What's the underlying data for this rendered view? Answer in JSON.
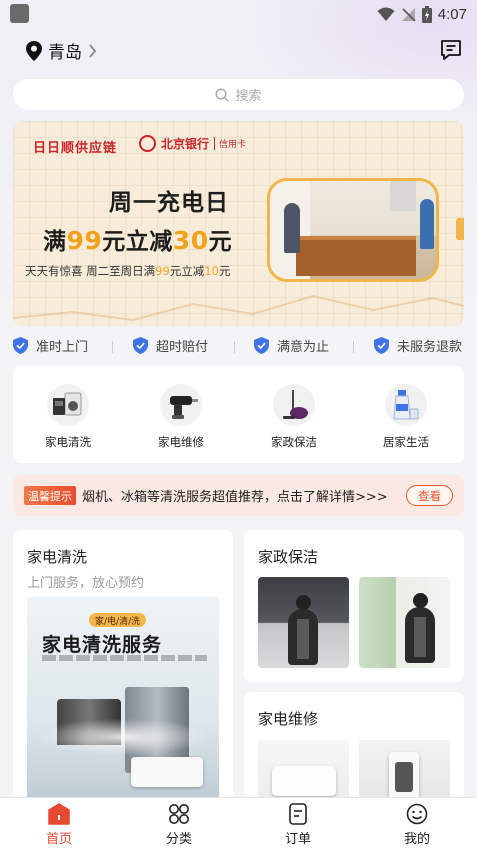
{
  "status_bar": {
    "time": "4:07"
  },
  "header": {
    "city": "青岛"
  },
  "search": {
    "placeholder": "搜索"
  },
  "banner": {
    "brand1": "日日顺供应链",
    "brand2_name": "北京银行",
    "brand2_sub": "信用卡",
    "title": "周一充电日",
    "promo_parts": [
      "满",
      "99",
      "元立减",
      "30",
      "元"
    ],
    "sub_parts": [
      "天天有惊喜 周二至周日满",
      "99",
      "元立减",
      "10",
      "元"
    ]
  },
  "guarantees": [
    "准时上门",
    "超时赔付",
    "满意为止",
    "未服务退款"
  ],
  "services": [
    {
      "label": "家电清洗",
      "icon": "washing-machine-icon"
    },
    {
      "label": "家电维修",
      "icon": "drill-icon"
    },
    {
      "label": "家政保洁",
      "icon": "vacuum-cleaner-icon"
    },
    {
      "label": "居家生活",
      "icon": "spray-bottle-icon"
    }
  ],
  "tip": {
    "tag": "温馨提示",
    "message": "烟机、冰箱等清洗服务超值推荐，点击了解详情>>>",
    "button": "查看"
  },
  "cards": {
    "appliance_cleaning": {
      "title": "家电清洗",
      "subtitle": "上门服务，放心预约",
      "poster_chip": "家/电/清/洗",
      "poster_title": "家电清洗服务"
    },
    "housekeeping": {
      "title": "家政保洁"
    },
    "appliance_repair": {
      "title": "家电维修"
    }
  },
  "tabbar": [
    {
      "label": "首页",
      "icon": "home-icon",
      "active": true
    },
    {
      "label": "分类",
      "icon": "category-icon",
      "active": false
    },
    {
      "label": "订单",
      "icon": "order-icon",
      "active": false
    },
    {
      "label": "我的",
      "icon": "profile-icon",
      "active": false
    }
  ],
  "colors": {
    "accent": "#e8482f",
    "banner_highlight": "#f0a21b",
    "shield_blue": "#3f73e8"
  }
}
